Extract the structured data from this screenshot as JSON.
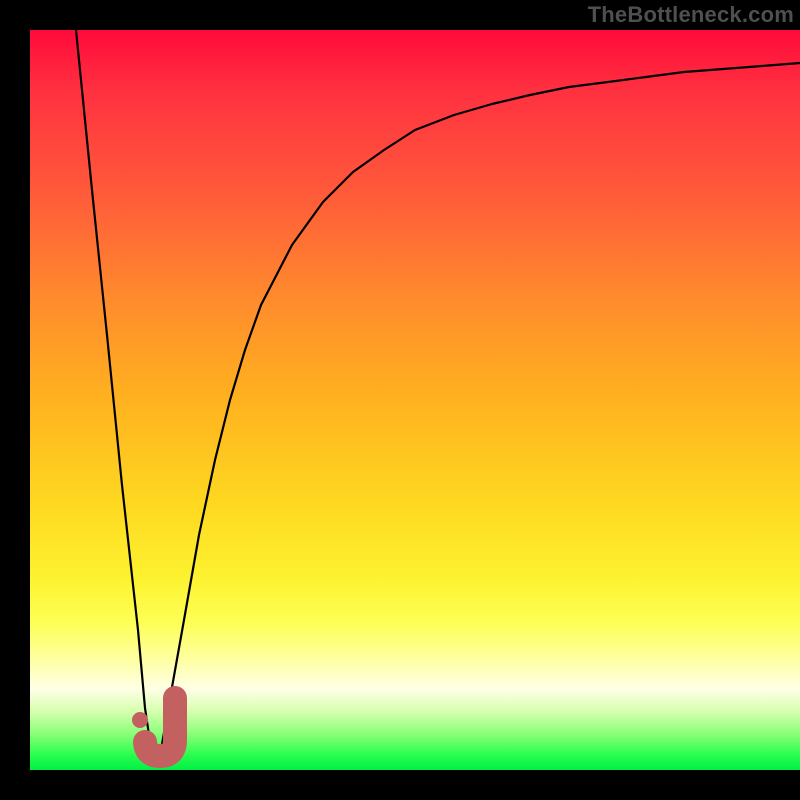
{
  "watermark": "TheBottleneck.com",
  "colors": {
    "frame_bg": "#000000",
    "watermark_text": "#4f4f4f",
    "curve": "#000000",
    "marker": "#c36060",
    "gradient_top": "#ff0a3a",
    "gradient_mid": "#fed820",
    "gradient_bottom": "#00ef46"
  },
  "chart_data": {
    "type": "line",
    "title": "",
    "xlabel": "",
    "ylabel": "",
    "xlim": [
      0,
      100
    ],
    "ylim": [
      0,
      100
    ],
    "grid": false,
    "legend": false,
    "annotations": [
      {
        "kind": "marker",
        "shape": "J",
        "approx_x": 17.5,
        "approx_y": 5,
        "color": "#c36060"
      }
    ],
    "series": [
      {
        "name": "curve",
        "x": [
          6,
          8,
          10,
          12,
          14,
          15,
          16,
          17,
          18,
          20,
          22,
          24,
          26,
          28,
          30,
          34,
          38,
          42,
          46,
          50,
          55,
          60,
          65,
          70,
          75,
          80,
          85,
          90,
          95,
          100
        ],
        "y": [
          100,
          78,
          58,
          38,
          18,
          8,
          1,
          2,
          8,
          20,
          32,
          42,
          50,
          57,
          63,
          71,
          77,
          81,
          84,
          86.5,
          88.5,
          90,
          91.2,
          92.2,
          93,
          93.7,
          94.3,
          94.8,
          95.2,
          95.6
        ]
      }
    ]
  }
}
